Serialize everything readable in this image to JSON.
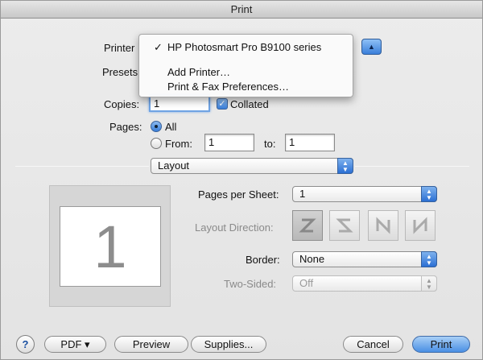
{
  "window": {
    "title": "Print"
  },
  "printer": {
    "label": "Printer",
    "menu": {
      "checkmark": "✓",
      "items": [
        "HP Photosmart Pro B9100 series",
        "Add Printer…",
        "Print & Fax Preferences…"
      ]
    },
    "toggle_icon": "disclosure-triangle-up-icon"
  },
  "presets": {
    "label": "Presets"
  },
  "copies": {
    "label": "Copies:",
    "value": "1",
    "collated_label": "Collated",
    "collated": true
  },
  "pages": {
    "label": "Pages:",
    "all_label": "All",
    "from_label": "From:",
    "from_value": "1",
    "to_label": "to:",
    "to_value": "1",
    "selected": "All"
  },
  "section_popup": {
    "value": "Layout"
  },
  "preview": {
    "page_number": "1"
  },
  "layout": {
    "pages_per_sheet_label": "Pages per Sheet:",
    "pages_per_sheet_value": "1",
    "direction_label": "Layout Direction:",
    "border_label": "Border:",
    "border_value": "None",
    "two_sided_label": "Two-Sided:",
    "two_sided_value": "Off"
  },
  "buttons": {
    "help": "?",
    "pdf": "PDF ▾",
    "preview": "Preview",
    "supplies": "Supplies...",
    "cancel": "Cancel",
    "print": "Print"
  },
  "colors": {
    "accent": "#3a7fda",
    "window_bg": "#e8e8e8"
  }
}
